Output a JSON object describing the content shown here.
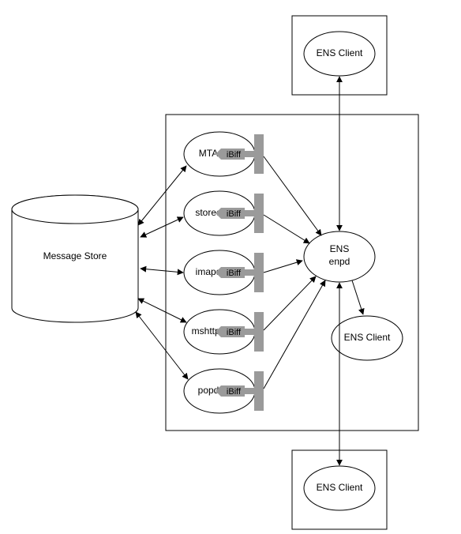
{
  "store": {
    "label": "Message Store"
  },
  "daemons": [
    {
      "label": "MTA",
      "ibiff": "iBiff"
    },
    {
      "label": "stored",
      "ibiff": "iBiff"
    },
    {
      "label": "imapd",
      "ibiff": "iBiff"
    },
    {
      "label": "mshttpd",
      "ibiff": "iBiff"
    },
    {
      "label": "popd",
      "ibiff": "iBiff"
    }
  ],
  "ens": {
    "line1": "ENS",
    "line2": "enpd"
  },
  "clients": {
    "top": "ENS Client",
    "side": "ENS Client",
    "bottom": "ENS Client"
  }
}
